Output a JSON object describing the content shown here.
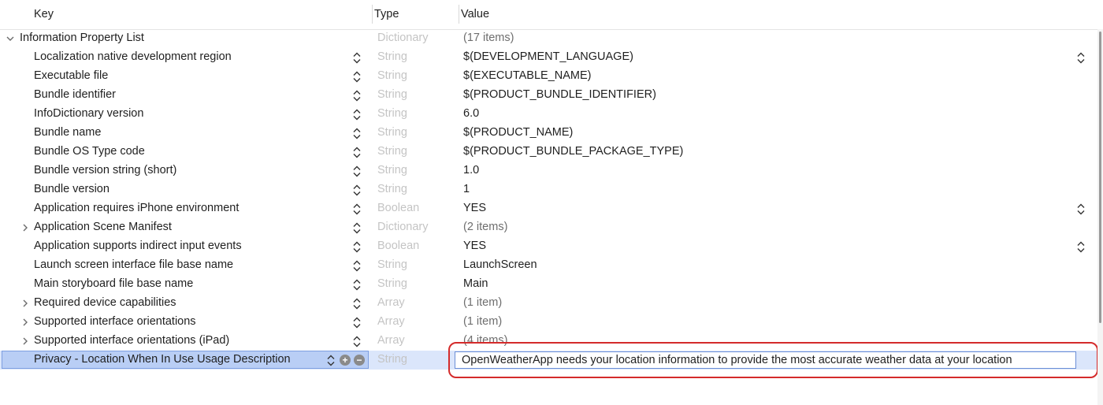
{
  "columns": {
    "key": "Key",
    "type": "Type",
    "value": "Value"
  },
  "root": {
    "key": "Information Property List",
    "type": "Dictionary",
    "value": "(17 items)"
  },
  "rows": [
    {
      "key": "Localization native development region",
      "type": "String",
      "value": "$(DEVELOPMENT_LANGUAGE)"
    },
    {
      "key": "Executable file",
      "type": "String",
      "value": "$(EXECUTABLE_NAME)"
    },
    {
      "key": "Bundle identifier",
      "type": "String",
      "value": "$(PRODUCT_BUNDLE_IDENTIFIER)"
    },
    {
      "key": "InfoDictionary version",
      "type": "String",
      "value": "6.0"
    },
    {
      "key": "Bundle name",
      "type": "String",
      "value": "$(PRODUCT_NAME)"
    },
    {
      "key": "Bundle OS Type code",
      "type": "String",
      "value": "$(PRODUCT_BUNDLE_PACKAGE_TYPE)"
    },
    {
      "key": "Bundle version string (short)",
      "type": "String",
      "value": "1.0"
    },
    {
      "key": "Bundle version",
      "type": "String",
      "value": "1"
    },
    {
      "key": "Application requires iPhone environment",
      "type": "Boolean",
      "value": "YES"
    },
    {
      "key": "Application Scene Manifest",
      "type": "Dictionary",
      "value": "(2 items)"
    },
    {
      "key": "Application supports indirect input events",
      "type": "Boolean",
      "value": "YES"
    },
    {
      "key": "Launch screen interface file base name",
      "type": "String",
      "value": "LaunchScreen"
    },
    {
      "key": "Main storyboard file base name",
      "type": "String",
      "value": "Main"
    },
    {
      "key": "Required device capabilities",
      "type": "Array",
      "value": "(1 item)"
    },
    {
      "key": "Supported interface orientations",
      "type": "Array",
      "value": "(1 item)"
    },
    {
      "key": "Supported interface orientations (iPad)",
      "type": "Array",
      "value": "(4 items)"
    }
  ],
  "selected": {
    "key": "Privacy - Location When In Use Usage Description",
    "type": "String",
    "value": "OpenWeatherApp needs your location information to provide the most accurate weather data at your location"
  },
  "colors": {
    "annotation": "#d42b2b",
    "selection": "#b9cef5"
  }
}
